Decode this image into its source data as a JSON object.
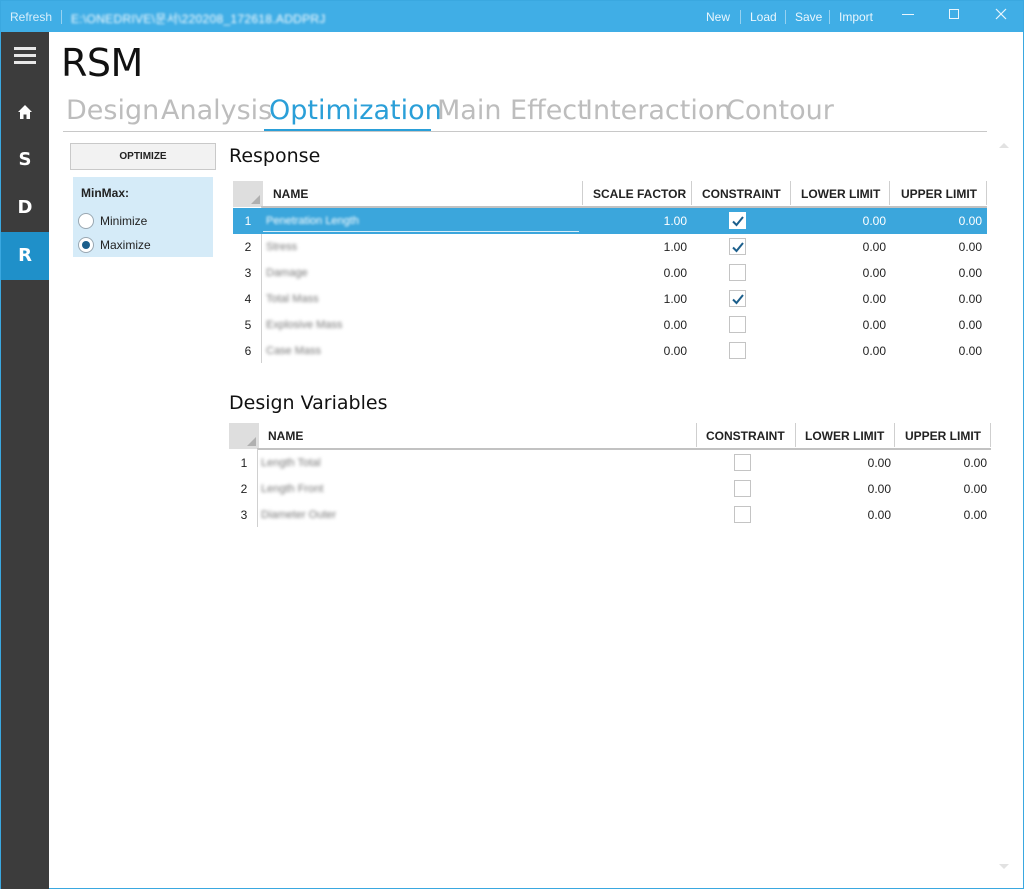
{
  "titlebar": {
    "refresh": "Refresh",
    "path": "E:\\ONEDRIVE\\문서\\220208_172618.ADDPRJ",
    "menu": [
      "New",
      "Load",
      "Save",
      "Import"
    ],
    "min_icon": "minimize-icon",
    "max_icon": "maximize-icon",
    "close_icon": "close-icon"
  },
  "sidebar": {
    "menu_icon": "hamburger-icon",
    "items": [
      {
        "label": "home-icon",
        "glyph": "⌂"
      },
      {
        "label": "S"
      },
      {
        "label": "D"
      },
      {
        "label": "R",
        "active": true
      }
    ]
  },
  "app": {
    "title": "RSM"
  },
  "tabs": [
    {
      "label": "Design"
    },
    {
      "label": "Analysis"
    },
    {
      "label": "Optimization",
      "active": true
    },
    {
      "label": "Main Effect"
    },
    {
      "label": "Interaction"
    },
    {
      "label": "Contour"
    }
  ],
  "optimize": {
    "button": "OPTIMIZE"
  },
  "minmax": {
    "label": "MinMax:",
    "options": [
      "Minimize",
      "Maximize"
    ],
    "selected": "Maximize"
  },
  "response": {
    "title": "Response",
    "columns": [
      "NAME",
      "SCALE FACTOR",
      "CONSTRAINT",
      "LOWER LIMIT",
      "UPPER LIMIT"
    ],
    "rows": [
      {
        "idx": "1",
        "name": "Penetration Length",
        "scale": "1.00",
        "constraint": true,
        "lower": "0.00",
        "upper": "0.00",
        "selected": true
      },
      {
        "idx": "2",
        "name": "Stress",
        "scale": "1.00",
        "constraint": true,
        "lower": "0.00",
        "upper": "0.00"
      },
      {
        "idx": "3",
        "name": "Damage",
        "scale": "0.00",
        "constraint": false,
        "lower": "0.00",
        "upper": "0.00"
      },
      {
        "idx": "4",
        "name": "Total Mass",
        "scale": "1.00",
        "constraint": true,
        "lower": "0.00",
        "upper": "0.00"
      },
      {
        "idx": "5",
        "name": "Explosive Mass",
        "scale": "0.00",
        "constraint": false,
        "lower": "0.00",
        "upper": "0.00"
      },
      {
        "idx": "6",
        "name": "Case Mass",
        "scale": "0.00",
        "constraint": false,
        "lower": "0.00",
        "upper": "0.00"
      }
    ]
  },
  "design_variables": {
    "title": "Design Variables",
    "columns": [
      "NAME",
      "CONSTRAINT",
      "LOWER LIMIT",
      "UPPER LIMIT"
    ],
    "rows": [
      {
        "idx": "1",
        "name": "Length Total",
        "constraint": false,
        "lower": "0.00",
        "upper": "0.00"
      },
      {
        "idx": "2",
        "name": "Length Front",
        "constraint": false,
        "lower": "0.00",
        "upper": "0.00"
      },
      {
        "idx": "3",
        "name": "Diameter Outer",
        "constraint": false,
        "lower": "0.00",
        "upper": "0.00"
      }
    ]
  },
  "colors": {
    "accent": "#40aee6",
    "selected_row": "#3ba6dc",
    "sidebar": "#3c3c3c",
    "sidebar_active": "#1f90c9",
    "check": "#1c5f8c"
  }
}
